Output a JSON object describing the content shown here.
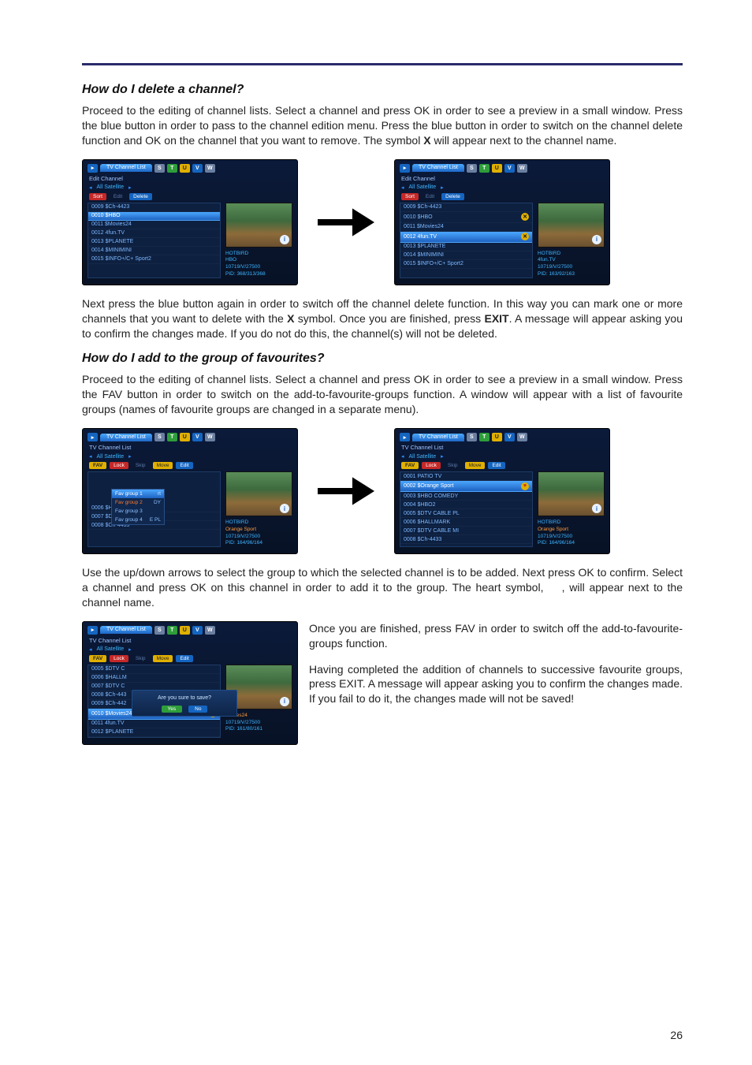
{
  "page_number": "26",
  "section1": {
    "heading": "How do I delete a channel?",
    "para1_a": "Proceed to the editing of channel lists. Select a channel and press OK in order to see a preview in a small window. Press the blue button in order to pass to the channel edition menu. Press the blue button in order to switch on the channel delete function and OK on the channel that you want to remove. The symbol ",
    "para1_b": "X",
    "para1_c": " will appear next to the channel name.",
    "para2_a": "Next press the blue button again in order to switch off the channel delete function. In this way you can mark one or more channels that you want to delete with the ",
    "para2_b": "X",
    "para2_c": " symbol. Once you are finished, press ",
    "para2_d": "EXIT",
    "para2_e": ". A message will appear asking you to confirm the changes made. If you do not do this, the channel(s) will not be deleted."
  },
  "section2": {
    "heading": "How do I add to the group of favourites?",
    "para1": "Proceed to the editing of channel lists. Select a channel and press OK in order to see a preview in a small window. Press the FAV button in order to switch on the add-to-favourite-groups function. A window will appear with a list of favourite groups (names of favourite groups are changed in a separate menu).",
    "para2_a": "Use the up/down arrows to select the group to which the selected channel is to be added. Next press OK to confirm. Select a channel and press OK on this channel in order to add it to the group. The heart symbol, ",
    "para2_b": ", will appear next to the channel name.",
    "para3": "Once you are finished, press FAV in order to switch off the add-to-favourite-groups function.",
    "para4": "Having completed the addition of channels to successive favourite groups, press EXIT. A message will appear asking you to confirm the changes made. If you fail to do it, the changes made will not be saved!"
  },
  "stb_common": {
    "tab_main": "TV Channel List",
    "all_sat": "All Satellite",
    "sq_red": "S",
    "sq_green": "T",
    "sq_yellow": "U",
    "sq_blue": "V",
    "sq_grey": "W",
    "info_i": "i"
  },
  "stb_delete": {
    "subtitle": "Edit Channel",
    "btn_sort": "Sort",
    "btn_edit": "Edit",
    "btn_delete": "Delete",
    "preview_name": "HOTBIRD",
    "left": {
      "channels": [
        "0009 $Ch-4423",
        "0010 $HBO",
        "0011 $Movies24",
        "0012 4fun.TV",
        "0013 $PLANETE",
        "0014 $MINIMINI",
        "0015 $INFO+/C+ Sport2"
      ],
      "info_line2": "HBO",
      "info_line3": "10719/V/27500",
      "info_line4": "PID: 368/313/368"
    },
    "right": {
      "channels": [
        "0009 $Ch-4423",
        "0010 $HBO",
        "0011 $Movies24",
        "0012 4fun.TV",
        "0013 $PLANETE",
        "0014 $MINIMINI",
        "0015 $INFO+/C+ Sport2"
      ],
      "info_line2": "4fun.TV",
      "info_line3": "10719/V/27500",
      "info_line4": "PID: 163/92/163"
    }
  },
  "stb_fav": {
    "subtitle": "TV Channel List",
    "btn_fav": "FAV",
    "btn_lock": "Lock",
    "btn_skip": "Skip",
    "btn_move": "Move",
    "btn_edit": "Edit",
    "preview_name": "HOTBIRD",
    "left": {
      "popup": [
        "Fav group 1",
        "Fav group 2",
        "Fav group 3",
        "Fav group 4"
      ],
      "popup_suffix1": "rt",
      "popup_suffix2": "DY",
      "popup_suffix3": "E PL",
      "channels_below": [
        "0006 $HALLMARK",
        "0007 $DTV CABLE MI",
        "0008 $Ch-4433"
      ],
      "info_line2": "Orange Sport",
      "info_line3": "10719/V/27500",
      "info_line4": "PID: 164/96/164"
    },
    "right": {
      "channels": [
        "0001 PATIO TV",
        "0002 $Orange Sport",
        "0003 $HBO COMEDY",
        "0004 $HBO2",
        "0005 $DTV CABLE PL",
        "0006 $HALLMARK",
        "0007 $DTV CABLE MI",
        "0008 $Ch-4433"
      ],
      "info_line2": "Orange Sport",
      "info_line3": "10719/V/27500",
      "info_line4": "PID: 164/96/164"
    }
  },
  "stb_save": {
    "subtitle": "TV Channel List",
    "channels": [
      "0005 $DTV C",
      "0006 $HALLM",
      "0007 $DTV C",
      "0008 $Ch-443",
      "0009 $Ch-442",
      "0010 $Movies24",
      "0011 4fun.TV",
      "0012 $PLANETE"
    ],
    "dialog_text": "Are you sure to save?",
    "dialog_yes": "Yes",
    "dialog_no": "No",
    "info_line2": "Movies24",
    "info_line3": "10719/V/27500",
    "info_line4": "PID: 161/80/161"
  }
}
